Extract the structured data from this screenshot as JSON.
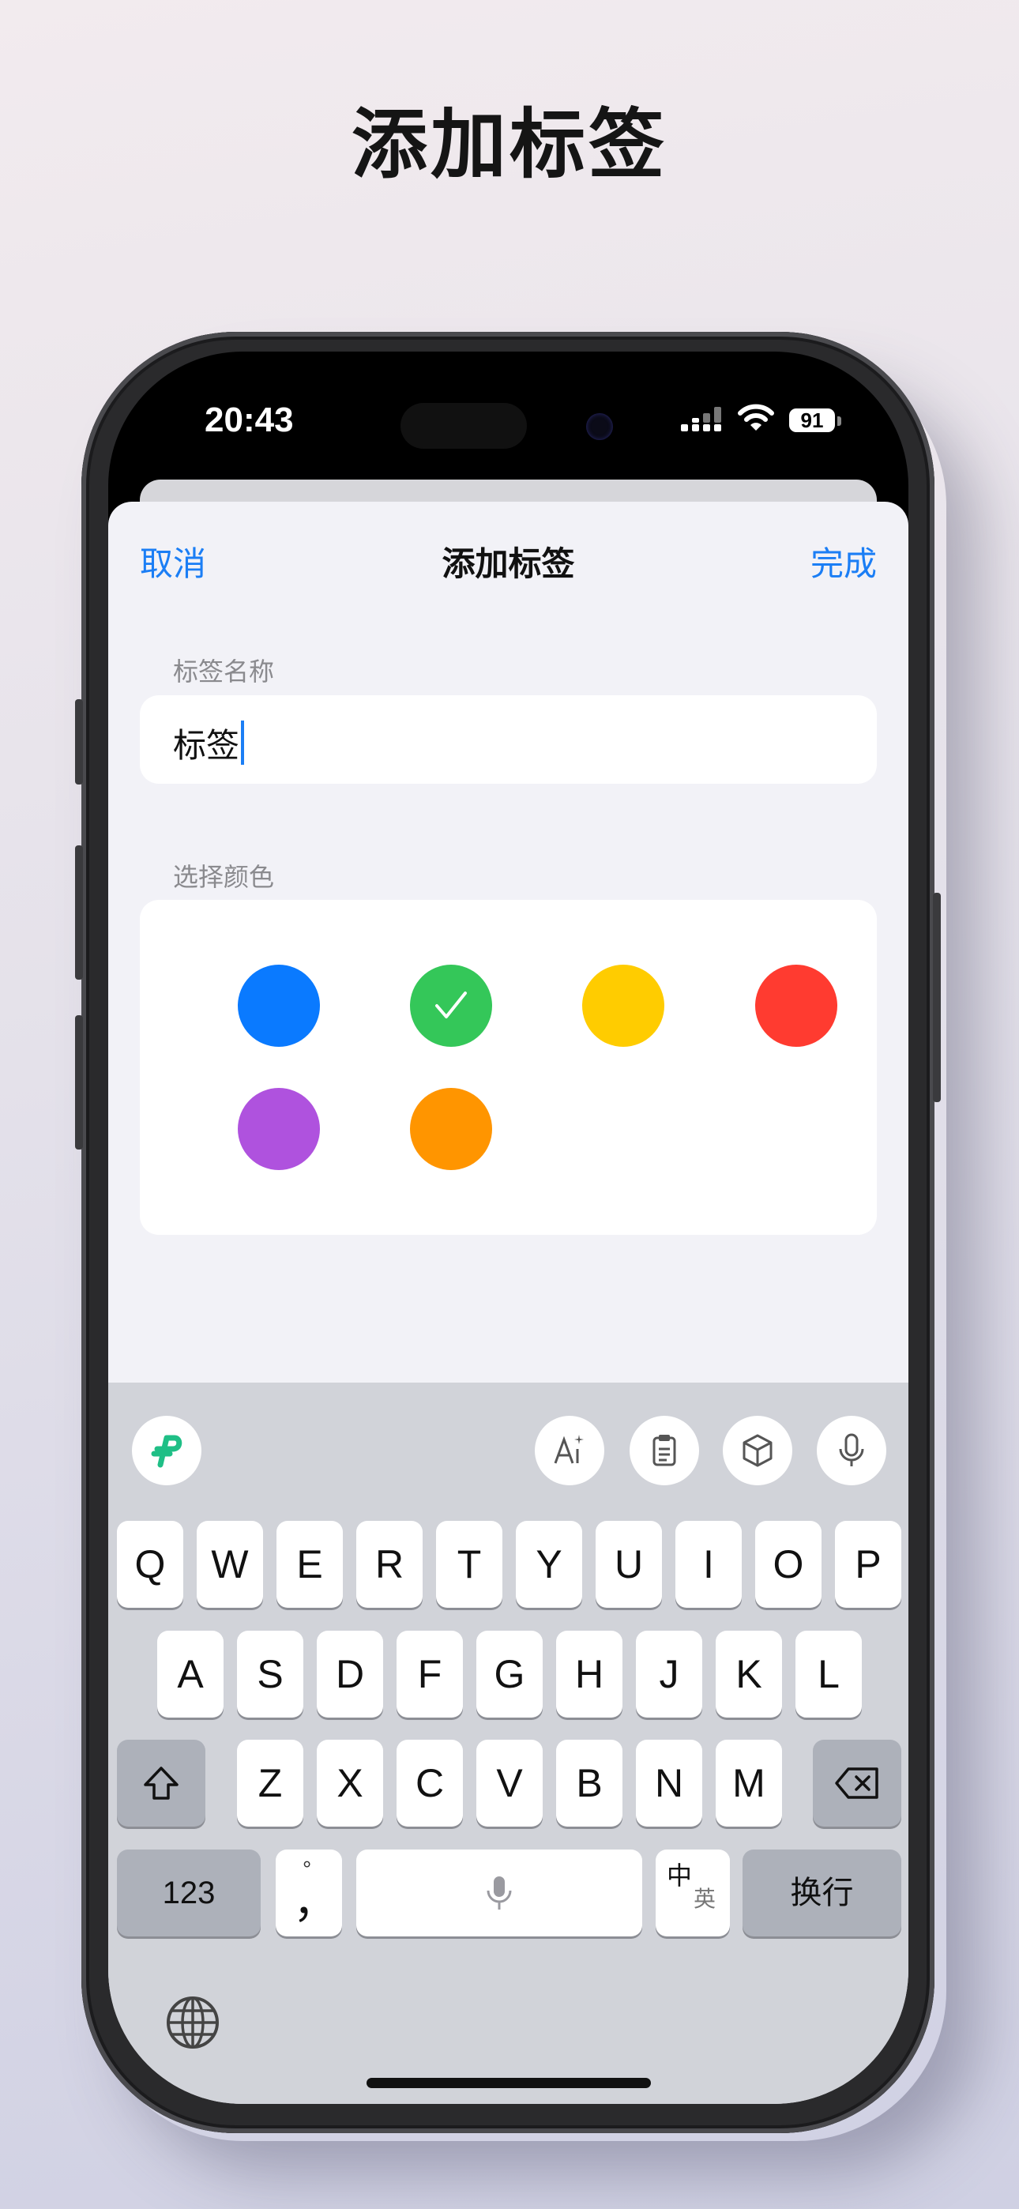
{
  "promo": {
    "title": "添加标签"
  },
  "status_bar": {
    "time": "20:43",
    "battery": "91"
  },
  "nav": {
    "cancel": "取消",
    "title": "添加标签",
    "done": "完成"
  },
  "name_section": {
    "label": "标签名称",
    "value": "标签"
  },
  "color_section": {
    "label": "选择颜色",
    "colors": [
      {
        "name": "blue",
        "hex": "#0a7aff",
        "selected": false
      },
      {
        "name": "green",
        "hex": "#34c759",
        "selected": true
      },
      {
        "name": "yellow",
        "hex": "#ffcc00",
        "selected": false
      },
      {
        "name": "red",
        "hex": "#ff3b30",
        "selected": false
      },
      {
        "name": "purple",
        "hex": "#af52de",
        "selected": false
      },
      {
        "name": "orange",
        "hex": "#ff9500",
        "selected": false
      }
    ]
  },
  "keyboard": {
    "row1": [
      "Q",
      "W",
      "E",
      "R",
      "T",
      "Y",
      "U",
      "I",
      "O",
      "P"
    ],
    "row2": [
      "A",
      "S",
      "D",
      "F",
      "G",
      "H",
      "J",
      "K",
      "L"
    ],
    "row3": [
      "Z",
      "X",
      "C",
      "V",
      "B",
      "N",
      "M"
    ],
    "numbers_key": "123",
    "punct_key_top": "°",
    "punct_key_main": "，",
    "lang_key_top": "中",
    "lang_key_bottom": "英",
    "return_key": "换行",
    "icons": [
      "app-logo-icon",
      "ai-text-icon",
      "clipboard-icon",
      "cube-icon",
      "microphone-icon",
      "shift-icon",
      "delete-icon",
      "globe-icon"
    ]
  }
}
